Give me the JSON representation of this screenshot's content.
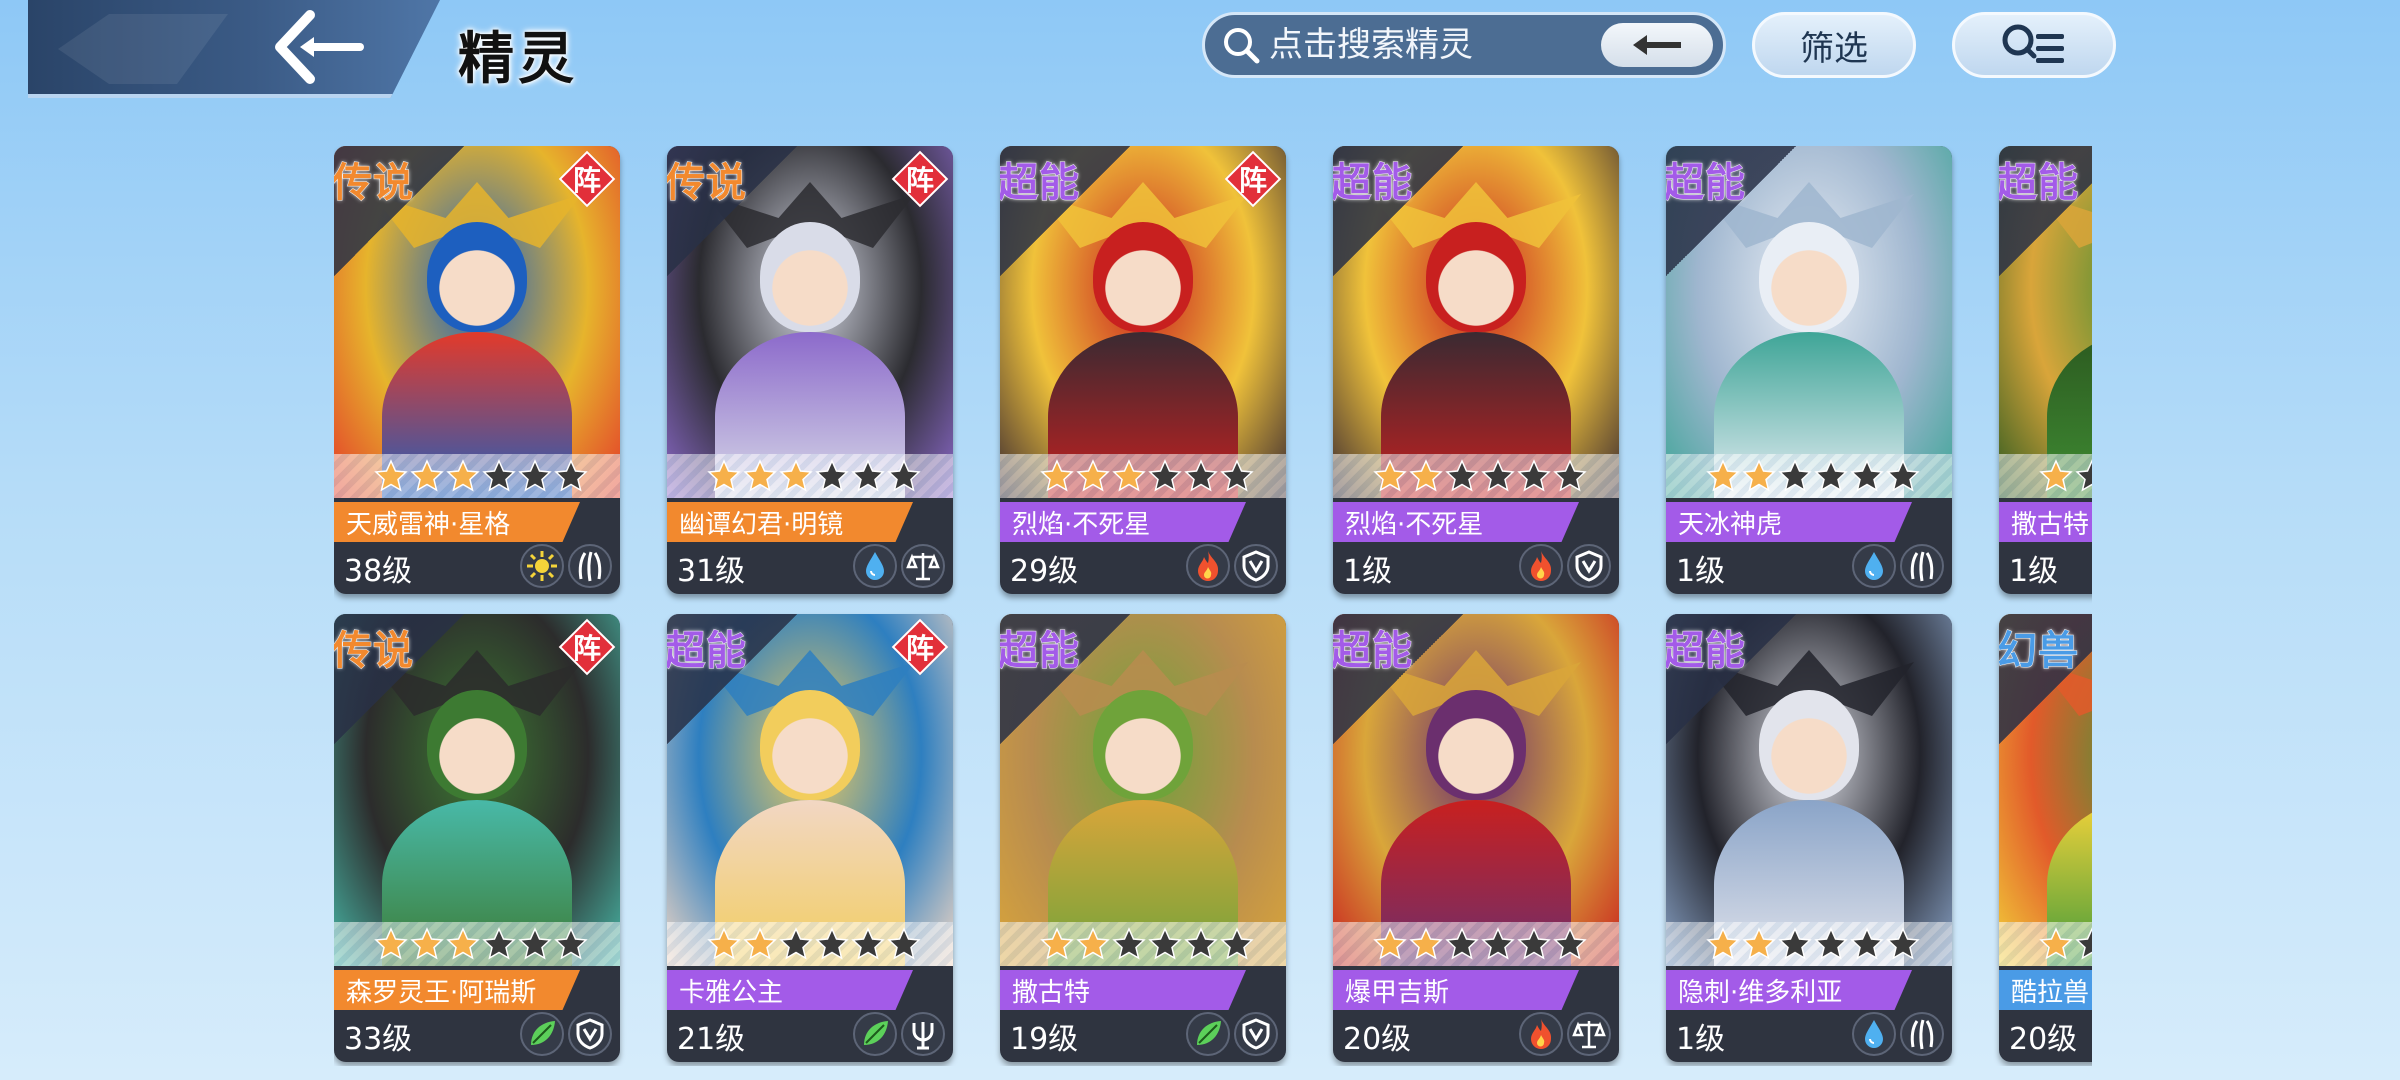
{
  "header": {
    "title": "精灵",
    "search_placeholder": "点击搜索精灵",
    "filter_label": "筛选"
  },
  "colors": {
    "legend": "#f2892e",
    "super": "#a35be8",
    "beast": "#4a9be6",
    "formation": "#e22f3a",
    "star_filled": "#f6b04a",
    "star_empty": "#3a3a3a"
  },
  "cards": [
    {
      "rarity": "传说",
      "rarity_type": "legend",
      "formation": "阵",
      "name": "天威雷神·星格",
      "level": "38级",
      "stars": 3,
      "attrs": [
        "light-icon",
        "claw-icon"
      ],
      "palette": [
        "#1d5fbf",
        "#e6b42c",
        "#e33a2a"
      ]
    },
    {
      "rarity": "传说",
      "rarity_type": "legend",
      "formation": "阵",
      "name": "幽谭幻君·明镜",
      "level": "31级",
      "stars": 3,
      "attrs": [
        "water-icon",
        "balance-icon"
      ],
      "palette": [
        "#d9dce8",
        "#2b2b30",
        "#8c6acb"
      ]
    },
    {
      "rarity": "超能",
      "rarity_type": "super",
      "formation": "阵",
      "name": "烈焰·不死星",
      "level": "29级",
      "stars": 3,
      "attrs": [
        "fire-icon",
        "shield-icon"
      ],
      "palette": [
        "#c8201f",
        "#f0c23a",
        "#3a2a32"
      ]
    },
    {
      "rarity": "超能",
      "rarity_type": "super",
      "formation": "",
      "name": "烈焰·不死星",
      "level": "1级",
      "stars": 2,
      "attrs": [
        "fire-icon",
        "shield-icon"
      ],
      "palette": [
        "#c8201f",
        "#f0c23a",
        "#3a2a32"
      ]
    },
    {
      "rarity": "超能",
      "rarity_type": "super",
      "formation": "",
      "name": "天冰神虎",
      "level": "1级",
      "stars": 2,
      "attrs": [
        "water-icon",
        "claw-icon"
      ],
      "palette": [
        "#e9eef5",
        "#9fb6cf",
        "#3ea597"
      ]
    },
    {
      "rarity": "超能",
      "rarity_type": "super",
      "formation": "",
      "name": "撒古特",
      "level": "1级",
      "stars": 1,
      "attrs": [],
      "palette": [
        "#3f8c33",
        "#d9a53a",
        "#2c5a20"
      ]
    },
    {
      "rarity": "传说",
      "rarity_type": "legend",
      "formation": "阵",
      "name": "森罗灵王·阿瑞斯",
      "level": "33级",
      "stars": 3,
      "attrs": [
        "leaf-icon",
        "shield-icon"
      ],
      "palette": [
        "#3d7a32",
        "#2c2c2c",
        "#48b9a8"
      ]
    },
    {
      "rarity": "超能",
      "rarity_type": "super",
      "formation": "阵",
      "name": "卡雅公主",
      "level": "21级",
      "stars": 2,
      "attrs": [
        "leaf-icon",
        "trident-icon"
      ],
      "palette": [
        "#f2cd5c",
        "#2e7fc0",
        "#f2d7c4"
      ]
    },
    {
      "rarity": "超能",
      "rarity_type": "super",
      "formation": "",
      "name": "撒古特",
      "level": "19级",
      "stars": 2,
      "attrs": [
        "leaf-icon",
        "shield-icon"
      ],
      "palette": [
        "#6fa33a",
        "#b88c4f",
        "#d9a53a"
      ]
    },
    {
      "rarity": "超能",
      "rarity_type": "super",
      "formation": "",
      "name": "爆甲吉斯",
      "level": "20级",
      "stars": 2,
      "attrs": [
        "fire-icon",
        "balance-icon"
      ],
      "palette": [
        "#6b2f6e",
        "#d9a63a",
        "#c8201f"
      ]
    },
    {
      "rarity": "超能",
      "rarity_type": "super",
      "formation": "",
      "name": "隐刺·维多利亚",
      "level": "1级",
      "stars": 2,
      "attrs": [
        "water-icon",
        "claw-icon"
      ],
      "palette": [
        "#e2e4ec",
        "#22232b",
        "#8aa4c8"
      ]
    },
    {
      "rarity": "幻兽",
      "rarity_type": "beast",
      "formation": "",
      "name": "酷拉兽",
      "level": "20级",
      "stars": 1,
      "attrs": [],
      "palette": [
        "#3f9a3a",
        "#e25a2a",
        "#f2d23a"
      ]
    }
  ]
}
